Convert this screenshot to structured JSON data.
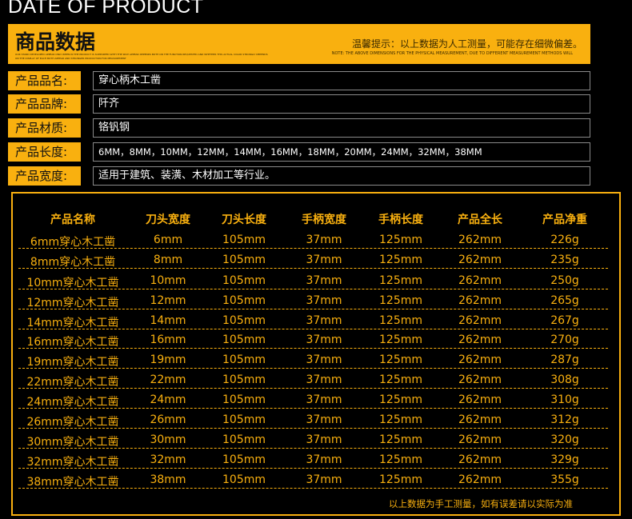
{
  "heading": "DATE OF PRODUCT",
  "banner": {
    "title": "商品数据",
    "tip": "温馨提示：以上数据为人工测量，可能存在细微偏差。",
    "tip_en": "NOTE: THE ABOVE DIMENSIONS FOR THE PHYSICAL MEASUREMENT, DUE TO DIFFERENT MEASUREMENT METHODS WILL"
  },
  "specs": [
    {
      "label": "产品品名:",
      "value": "穿心柄木工凿"
    },
    {
      "label": "产品品牌:",
      "value": "阡齐"
    },
    {
      "label": "产品材质:",
      "value": "铬钒钢"
    },
    {
      "label": "产品长度:",
      "value": "6MM，8MM，10MM，12MM，14MM，16MM，18MM，20MM，24MM，32MM，38MM"
    },
    {
      "label": "产品宽度:",
      "value": "适用于建筑、装潢、木材加工等行业。"
    }
  ],
  "table": {
    "headers": [
      "产品名称",
      "刀头宽度",
      "刀头长度",
      "手柄宽度",
      "手柄长度",
      "产品全长",
      "产品净重"
    ],
    "rows": [
      [
        "6mm穿心木工凿",
        "6mm",
        "105mm",
        "37mm",
        "125mm",
        "262mm",
        "226g"
      ],
      [
        "8mm穿心木工凿",
        "8mm",
        "105mm",
        "37mm",
        "125mm",
        "262mm",
        "235g"
      ],
      [
        "10mm穿心木工凿",
        "10mm",
        "105mm",
        "37mm",
        "125mm",
        "262mm",
        "250g"
      ],
      [
        "12mm穿心木工凿",
        "12mm",
        "105mm",
        "37mm",
        "125mm",
        "262mm",
        "265g"
      ],
      [
        "14mm穿心木工凿",
        "14mm",
        "105mm",
        "37mm",
        "125mm",
        "262mm",
        "267g"
      ],
      [
        "16mm穿心木工凿",
        "16mm",
        "105mm",
        "37mm",
        "125mm",
        "262mm",
        "270g"
      ],
      [
        "19mm穿心木工凿",
        "19mm",
        "105mm",
        "37mm",
        "125mm",
        "262mm",
        "287g"
      ],
      [
        "22mm穿心木工凿",
        "22mm",
        "105mm",
        "37mm",
        "125mm",
        "262mm",
        "308g"
      ],
      [
        "24mm穿心木工凿",
        "24mm",
        "105mm",
        "37mm",
        "125mm",
        "262mm",
        "310g"
      ],
      [
        "26mm穿心木工凿",
        "26mm",
        "105mm",
        "37mm",
        "125mm",
        "262mm",
        "312g"
      ],
      [
        "30mm穿心木工凿",
        "30mm",
        "105mm",
        "37mm",
        "125mm",
        "262mm",
        "320g"
      ],
      [
        "32mm穿心木工凿",
        "32mm",
        "105mm",
        "37mm",
        "125mm",
        "262mm",
        "329g"
      ],
      [
        "38mm穿心木工凿",
        "38mm",
        "105mm",
        "37mm",
        "125mm",
        "262mm",
        "355g"
      ]
    ]
  },
  "footnote": "以上数据为手工测量，如有误差请以实际为准",
  "colors": {
    "accent": "#f9b00f",
    "background": "#000000"
  }
}
